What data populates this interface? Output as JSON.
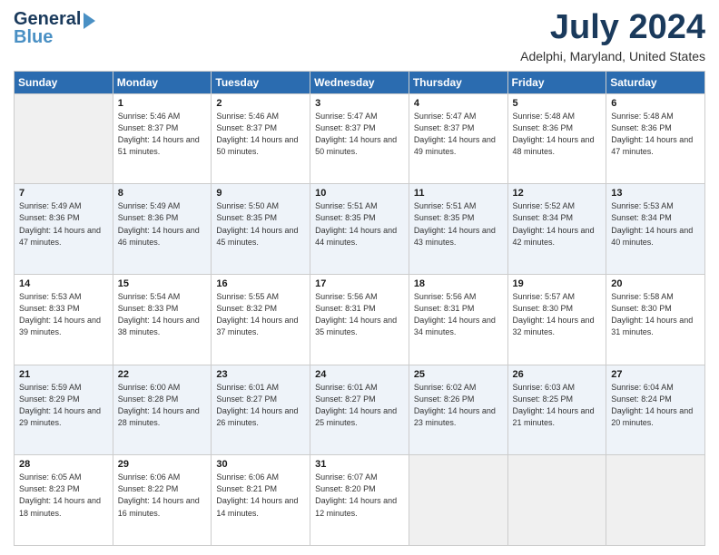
{
  "logo": {
    "line1": "General",
    "line2": "Blue",
    "arrow": "▶"
  },
  "title": "July 2024",
  "subtitle": "Adelphi, Maryland, United States",
  "weekdays": [
    "Sunday",
    "Monday",
    "Tuesday",
    "Wednesday",
    "Thursday",
    "Friday",
    "Saturday"
  ],
  "weeks": [
    [
      {
        "day": "",
        "sunrise": "",
        "sunset": "",
        "daylight": ""
      },
      {
        "day": "1",
        "sunrise": "Sunrise: 5:46 AM",
        "sunset": "Sunset: 8:37 PM",
        "daylight": "Daylight: 14 hours and 51 minutes."
      },
      {
        "day": "2",
        "sunrise": "Sunrise: 5:46 AM",
        "sunset": "Sunset: 8:37 PM",
        "daylight": "Daylight: 14 hours and 50 minutes."
      },
      {
        "day": "3",
        "sunrise": "Sunrise: 5:47 AM",
        "sunset": "Sunset: 8:37 PM",
        "daylight": "Daylight: 14 hours and 50 minutes."
      },
      {
        "day": "4",
        "sunrise": "Sunrise: 5:47 AM",
        "sunset": "Sunset: 8:37 PM",
        "daylight": "Daylight: 14 hours and 49 minutes."
      },
      {
        "day": "5",
        "sunrise": "Sunrise: 5:48 AM",
        "sunset": "Sunset: 8:36 PM",
        "daylight": "Daylight: 14 hours and 48 minutes."
      },
      {
        "day": "6",
        "sunrise": "Sunrise: 5:48 AM",
        "sunset": "Sunset: 8:36 PM",
        "daylight": "Daylight: 14 hours and 47 minutes."
      }
    ],
    [
      {
        "day": "7",
        "sunrise": "Sunrise: 5:49 AM",
        "sunset": "Sunset: 8:36 PM",
        "daylight": "Daylight: 14 hours and 47 minutes."
      },
      {
        "day": "8",
        "sunrise": "Sunrise: 5:49 AM",
        "sunset": "Sunset: 8:36 PM",
        "daylight": "Daylight: 14 hours and 46 minutes."
      },
      {
        "day": "9",
        "sunrise": "Sunrise: 5:50 AM",
        "sunset": "Sunset: 8:35 PM",
        "daylight": "Daylight: 14 hours and 45 minutes."
      },
      {
        "day": "10",
        "sunrise": "Sunrise: 5:51 AM",
        "sunset": "Sunset: 8:35 PM",
        "daylight": "Daylight: 14 hours and 44 minutes."
      },
      {
        "day": "11",
        "sunrise": "Sunrise: 5:51 AM",
        "sunset": "Sunset: 8:35 PM",
        "daylight": "Daylight: 14 hours and 43 minutes."
      },
      {
        "day": "12",
        "sunrise": "Sunrise: 5:52 AM",
        "sunset": "Sunset: 8:34 PM",
        "daylight": "Daylight: 14 hours and 42 minutes."
      },
      {
        "day": "13",
        "sunrise": "Sunrise: 5:53 AM",
        "sunset": "Sunset: 8:34 PM",
        "daylight": "Daylight: 14 hours and 40 minutes."
      }
    ],
    [
      {
        "day": "14",
        "sunrise": "Sunrise: 5:53 AM",
        "sunset": "Sunset: 8:33 PM",
        "daylight": "Daylight: 14 hours and 39 minutes."
      },
      {
        "day": "15",
        "sunrise": "Sunrise: 5:54 AM",
        "sunset": "Sunset: 8:33 PM",
        "daylight": "Daylight: 14 hours and 38 minutes."
      },
      {
        "day": "16",
        "sunrise": "Sunrise: 5:55 AM",
        "sunset": "Sunset: 8:32 PM",
        "daylight": "Daylight: 14 hours and 37 minutes."
      },
      {
        "day": "17",
        "sunrise": "Sunrise: 5:56 AM",
        "sunset": "Sunset: 8:31 PM",
        "daylight": "Daylight: 14 hours and 35 minutes."
      },
      {
        "day": "18",
        "sunrise": "Sunrise: 5:56 AM",
        "sunset": "Sunset: 8:31 PM",
        "daylight": "Daylight: 14 hours and 34 minutes."
      },
      {
        "day": "19",
        "sunrise": "Sunrise: 5:57 AM",
        "sunset": "Sunset: 8:30 PM",
        "daylight": "Daylight: 14 hours and 32 minutes."
      },
      {
        "day": "20",
        "sunrise": "Sunrise: 5:58 AM",
        "sunset": "Sunset: 8:30 PM",
        "daylight": "Daylight: 14 hours and 31 minutes."
      }
    ],
    [
      {
        "day": "21",
        "sunrise": "Sunrise: 5:59 AM",
        "sunset": "Sunset: 8:29 PM",
        "daylight": "Daylight: 14 hours and 29 minutes."
      },
      {
        "day": "22",
        "sunrise": "Sunrise: 6:00 AM",
        "sunset": "Sunset: 8:28 PM",
        "daylight": "Daylight: 14 hours and 28 minutes."
      },
      {
        "day": "23",
        "sunrise": "Sunrise: 6:01 AM",
        "sunset": "Sunset: 8:27 PM",
        "daylight": "Daylight: 14 hours and 26 minutes."
      },
      {
        "day": "24",
        "sunrise": "Sunrise: 6:01 AM",
        "sunset": "Sunset: 8:27 PM",
        "daylight": "Daylight: 14 hours and 25 minutes."
      },
      {
        "day": "25",
        "sunrise": "Sunrise: 6:02 AM",
        "sunset": "Sunset: 8:26 PM",
        "daylight": "Daylight: 14 hours and 23 minutes."
      },
      {
        "day": "26",
        "sunrise": "Sunrise: 6:03 AM",
        "sunset": "Sunset: 8:25 PM",
        "daylight": "Daylight: 14 hours and 21 minutes."
      },
      {
        "day": "27",
        "sunrise": "Sunrise: 6:04 AM",
        "sunset": "Sunset: 8:24 PM",
        "daylight": "Daylight: 14 hours and 20 minutes."
      }
    ],
    [
      {
        "day": "28",
        "sunrise": "Sunrise: 6:05 AM",
        "sunset": "Sunset: 8:23 PM",
        "daylight": "Daylight: 14 hours and 18 minutes."
      },
      {
        "day": "29",
        "sunrise": "Sunrise: 6:06 AM",
        "sunset": "Sunset: 8:22 PM",
        "daylight": "Daylight: 14 hours and 16 minutes."
      },
      {
        "day": "30",
        "sunrise": "Sunrise: 6:06 AM",
        "sunset": "Sunset: 8:21 PM",
        "daylight": "Daylight: 14 hours and 14 minutes."
      },
      {
        "day": "31",
        "sunrise": "Sunrise: 6:07 AM",
        "sunset": "Sunset: 8:20 PM",
        "daylight": "Daylight: 14 hours and 12 minutes."
      },
      {
        "day": "",
        "sunrise": "",
        "sunset": "",
        "daylight": ""
      },
      {
        "day": "",
        "sunrise": "",
        "sunset": "",
        "daylight": ""
      },
      {
        "day": "",
        "sunrise": "",
        "sunset": "",
        "daylight": ""
      }
    ]
  ]
}
